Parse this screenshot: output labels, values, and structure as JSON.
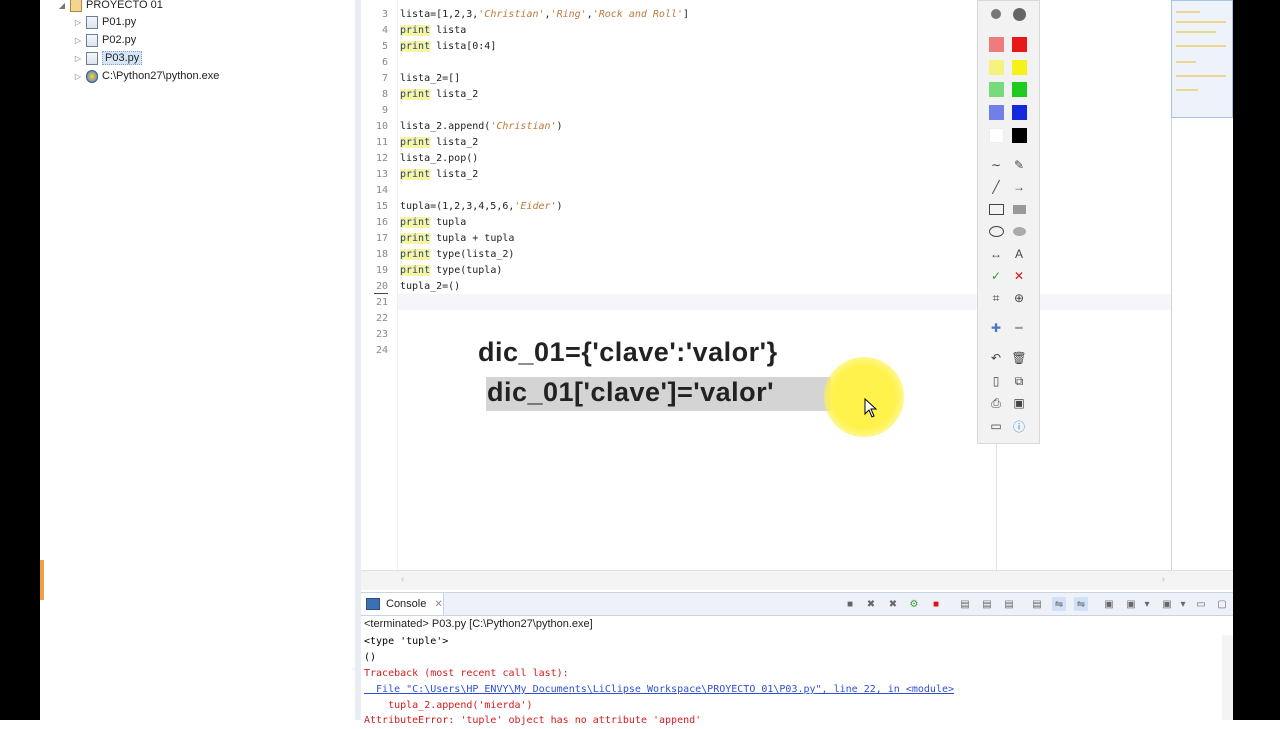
{
  "explorer": {
    "items": [
      {
        "label": "PROYECTO 01",
        "arrow": "◢",
        "icon": "project-folder-icon"
      },
      {
        "label": "P01.py",
        "arrow": "▷",
        "icon": "python-file-icon"
      },
      {
        "label": "P02.py",
        "arrow": "▷",
        "icon": "python-file-icon"
      },
      {
        "label": "P03.py",
        "arrow": "▷",
        "icon": "python-file-icon"
      },
      {
        "label": "C:\\Python27\\python.exe",
        "arrow": "▷",
        "icon": "python-interpreter-icon"
      }
    ]
  },
  "editor": {
    "line_numbers": [
      "3",
      "4",
      "5",
      "6",
      "7",
      "8",
      "9",
      "10",
      "11",
      "12",
      "13",
      "14",
      "15",
      "16",
      "17",
      "18",
      "19",
      "20",
      "21",
      "22",
      "23",
      "24"
    ],
    "lines": [
      {
        "kw": "",
        "code": "lista=[1,2,3,",
        "s1": "'Christian'",
        ",": ",",
        "s2": "'Ring'",
        "c2": ",",
        "s3": "'Rock and Roll'",
        "tail": "]"
      },
      {
        "kw": "print",
        "code": " lista"
      },
      {
        "kw": "print",
        "code": " lista[0:4]"
      },
      {
        "kw": "",
        "code": ""
      },
      {
        "kw": "",
        "code": "lista_2=[]"
      },
      {
        "kw": "print",
        "code": " lista_2"
      },
      {
        "kw": "",
        "code": ""
      },
      {
        "kw": "",
        "code": "lista_2.append(",
        "s1": "'Christian'",
        "tail": ")"
      },
      {
        "kw": "print",
        "code": " lista_2"
      },
      {
        "kw": "",
        "code": "lista_2.pop()"
      },
      {
        "kw": "print",
        "code": " lista_2"
      },
      {
        "kw": "",
        "code": ""
      },
      {
        "kw": "",
        "code": "tupla=(1,2,3,4,5,6,",
        "s1": "'Eider'",
        "tail": ")"
      },
      {
        "kw": "print",
        "code": " tupla"
      },
      {
        "kw": "print",
        "code": " tupla + tupla"
      },
      {
        "kw": "print",
        "code": " type(lista_2)"
      },
      {
        "kw": "print",
        "code": " type(tupla)"
      },
      {
        "kw": "",
        "code": "tupla_2=()"
      }
    ]
  },
  "overlay": {
    "line1": "dic_01={'clave':'valor'}",
    "line2": "dic_01['clave']='valor'"
  },
  "console": {
    "tab_label": "Console",
    "terminated": "<terminated> P03.py [C:\\Python27\\python.exe]",
    "out1": "<type 'tuple'>",
    "out2": "()",
    "tb1": "Traceback (most recent call last):",
    "tb2": "  File \"C:\\Users\\HP ENVY\\My Documents\\LiClipse Workspace\\PROYECTO 01\\P03.py\", line 22, in <module>",
    "tb3": "    tupla_2.append('mierda')",
    "tb4": "AttributeError: 'tuple' object has no attribute 'append'"
  },
  "colors": {
    "keyword_bg": "#f7f69c",
    "string": "#c07a3a",
    "error": "#d41c1c",
    "link": "#2f4fd8",
    "cursor_highlight": "#fff24a"
  }
}
